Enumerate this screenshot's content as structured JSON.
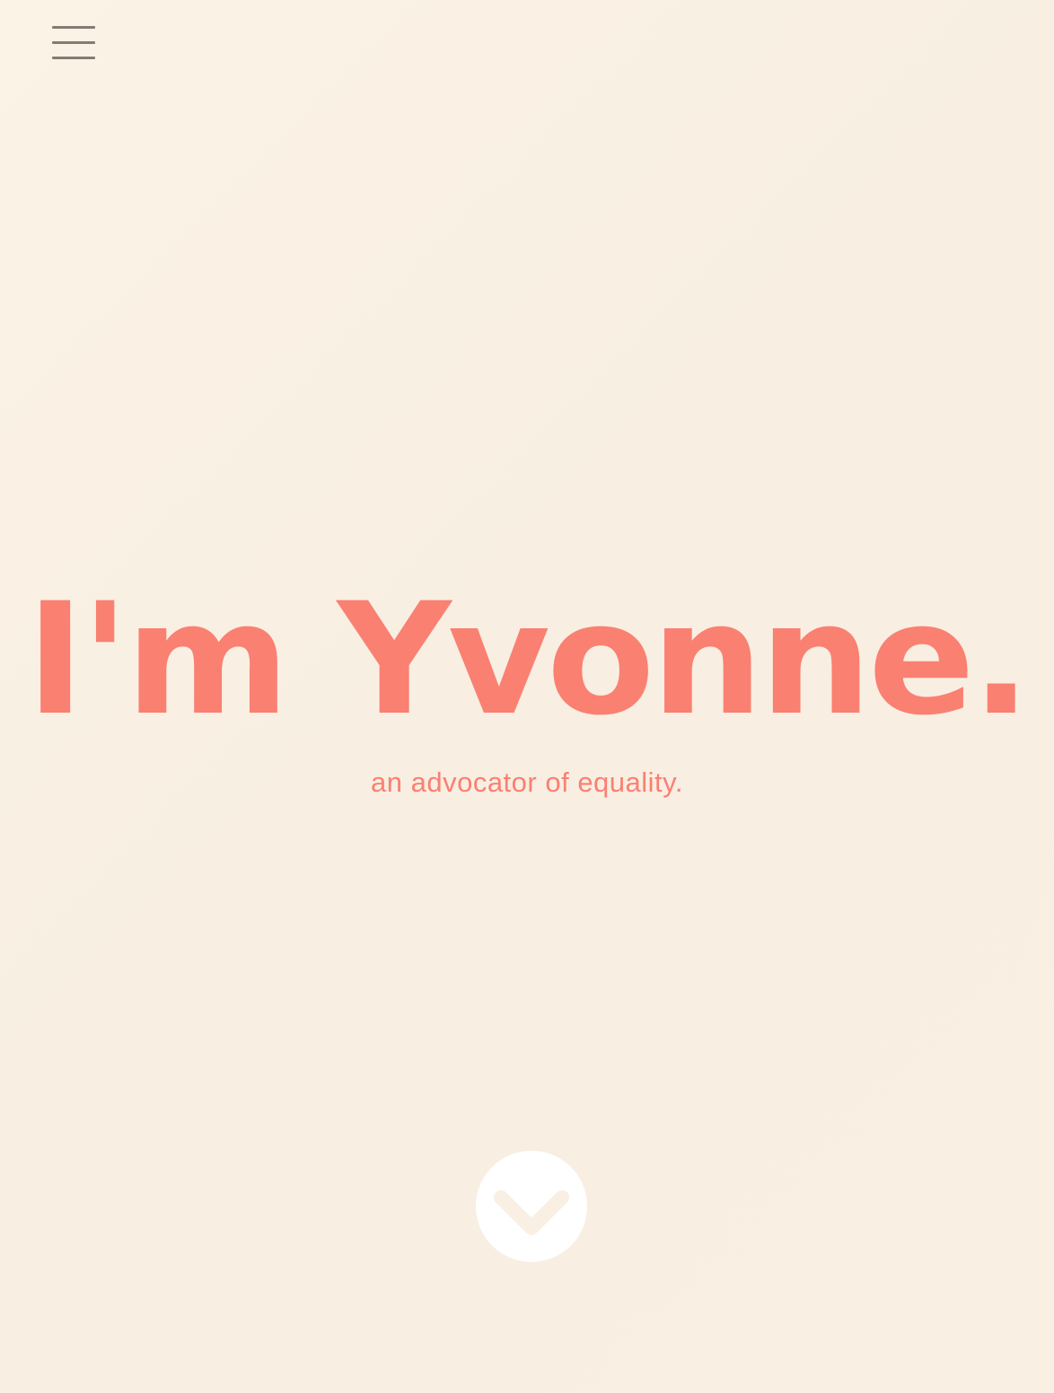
{
  "colors": {
    "accent": "#fa8072",
    "menu_icon": "#857b74",
    "scroll_button_bg": "#ffffff",
    "scroll_chevron": "#f9efe3"
  },
  "nav": {
    "menu_icon": "hamburger-menu-icon"
  },
  "hero": {
    "title": "I'm Yvonne.",
    "subtitle": "an advocator of equality."
  },
  "scroll": {
    "icon": "chevron-down-icon"
  }
}
